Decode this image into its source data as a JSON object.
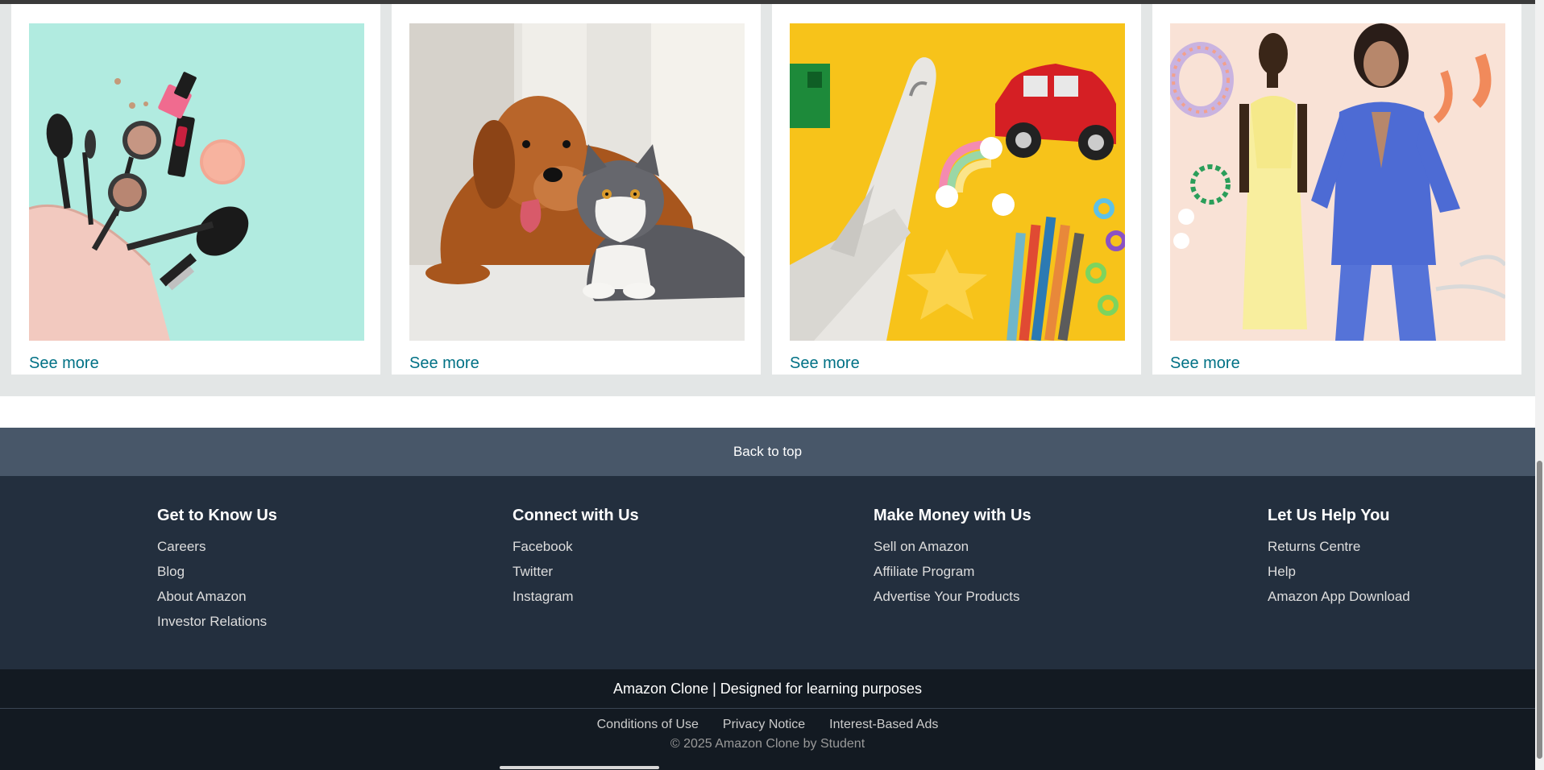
{
  "cards": [
    {
      "see_more": "See more"
    },
    {
      "see_more": "See more"
    },
    {
      "see_more": "See more"
    },
    {
      "see_more": "See more"
    }
  ],
  "back_to_top": "Back to top",
  "footer": {
    "columns": [
      {
        "title": "Get to Know Us",
        "links": [
          "Careers",
          "Blog",
          "About Amazon",
          "Investor Relations"
        ]
      },
      {
        "title": "Connect with Us",
        "links": [
          "Facebook",
          "Twitter",
          "Instagram"
        ]
      },
      {
        "title": "Make Money with Us",
        "links": [
          "Sell on Amazon",
          "Affiliate Program",
          "Advertise Your Products"
        ]
      },
      {
        "title": "Let Us Help You",
        "links": [
          "Returns Centre",
          "Help",
          "Amazon App Download"
        ]
      }
    ],
    "credit": "Amazon Clone | Designed for learning purposes",
    "legal_links": [
      "Conditions of Use",
      "Privacy Notice",
      "Interest-Based Ads"
    ],
    "copyright": "© 2025 Amazon Clone by Student"
  },
  "colors": {
    "link_teal": "#007185",
    "back_to_top_bg": "#485769",
    "footer_bg": "#232f3e",
    "footer_bottom_bg": "#131a22"
  }
}
